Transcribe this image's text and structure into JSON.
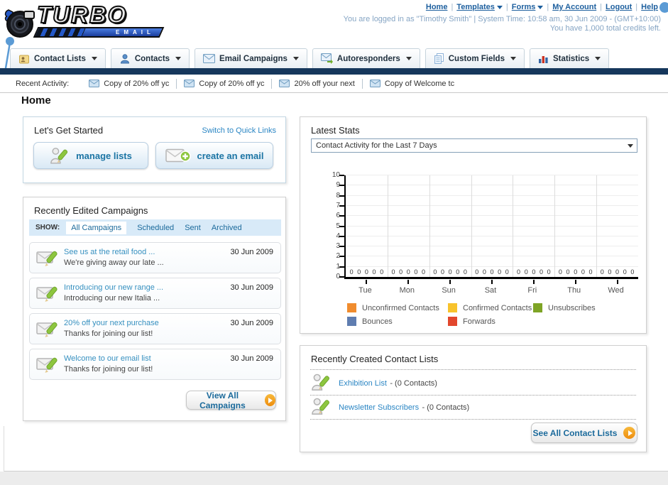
{
  "header": {
    "logo_title": "TURBO",
    "logo_subtitle": "EMAIL",
    "nav_links": [
      {
        "label": "Home",
        "has_dropdown": false
      },
      {
        "label": "Templates",
        "has_dropdown": true
      },
      {
        "label": "Forms",
        "has_dropdown": true
      },
      {
        "label": "My Account",
        "has_dropdown": false
      },
      {
        "label": "Logout",
        "has_dropdown": false
      },
      {
        "label": "Help",
        "has_dropdown": false
      }
    ],
    "login_info": "You are logged in as \"Timothy Smith\" | System Time: 10:58 am, 30 Jun 2009 - (GMT+10:00)",
    "credits_info": "You have 1,000 total credits left."
  },
  "nav_tabs": [
    {
      "label": "Contact Lists"
    },
    {
      "label": "Contacts"
    },
    {
      "label": "Email Campaigns"
    },
    {
      "label": "Autoresponders"
    },
    {
      "label": "Custom Fields"
    },
    {
      "label": "Statistics"
    }
  ],
  "recent_activity": {
    "label": "Recent Activity:",
    "items": [
      "Copy of 20% off yc",
      "Copy of 20% off yc",
      "20% off your next",
      "Copy of Welcome tc"
    ]
  },
  "page_title": "Home",
  "get_started": {
    "title": "Let's Get Started",
    "switch_link": "Switch to Quick Links",
    "buttons": [
      {
        "label": "manage lists"
      },
      {
        "label": "create an email"
      }
    ]
  },
  "campaigns": {
    "title": "Recently Edited Campaigns",
    "show_label": "SHOW:",
    "filters": [
      "All Campaigns",
      "Scheduled",
      "Sent",
      "Archived"
    ],
    "active_filter": "All Campaigns",
    "items": [
      {
        "title": "See us at the retail food ...",
        "subtitle": "We're giving away our late ...",
        "date": "30 Jun 2009"
      },
      {
        "title": "Introducing our new range ...",
        "subtitle": "Introducing our new Italia ...",
        "date": "30 Jun 2009"
      },
      {
        "title": "20% off your next purchase",
        "subtitle": "Thanks for joining our list!",
        "date": "30 Jun 2009"
      },
      {
        "title": "Welcome to our email list",
        "subtitle": "Thanks for joining our list!",
        "date": "30 Jun 2009"
      }
    ],
    "view_all_label": "View All Campaigns"
  },
  "latest_stats": {
    "title": "Latest Stats",
    "dropdown_value": "Contact Activity for the Last 7 Days"
  },
  "chart_data": {
    "type": "bar",
    "title": "Contact Activity for the Last 7 Days",
    "categories": [
      "Tue",
      "Mon",
      "Sun",
      "Sat",
      "Fri",
      "Thu",
      "Wed"
    ],
    "series": [
      {
        "name": "Unconfirmed Contacts",
        "color": "#F08C2E",
        "values": [
          0,
          0,
          0,
          0,
          0,
          0,
          0
        ]
      },
      {
        "name": "Confirmed Contacts",
        "color": "#F8C32C",
        "values": [
          0,
          0,
          0,
          0,
          0,
          0,
          0
        ]
      },
      {
        "name": "Unsubscribes",
        "color": "#7EA425",
        "values": [
          0,
          0,
          0,
          0,
          0,
          0,
          0
        ]
      },
      {
        "name": "Bounces",
        "color": "#5F7DB0",
        "values": [
          0,
          0,
          0,
          0,
          0,
          0,
          0
        ]
      },
      {
        "name": "Forwards",
        "color": "#E2472D",
        "values": [
          0,
          0,
          0,
          0,
          0,
          0,
          0
        ]
      }
    ],
    "xlabel": "",
    "ylabel": "",
    "ylim": [
      0,
      10
    ],
    "ytick_step": 1,
    "grid": true,
    "legend_position": "bottom"
  },
  "contact_lists": {
    "title": "Recently Created Contact Lists",
    "items": [
      {
        "name": "Exhibition List",
        "detail": "- (0 Contacts)"
      },
      {
        "name": "Newsletter Subscribers",
        "detail": "- (0 Contacts)"
      }
    ],
    "see_all_label": "See All Contact Lists"
  },
  "colors": {
    "navy_bar": "#16375c",
    "link_blue": "#1d5f9e",
    "accent_blue": "#1b6a9b",
    "bubble_blue": "#5b9bd5",
    "orange_arrow": "#ef9512"
  }
}
